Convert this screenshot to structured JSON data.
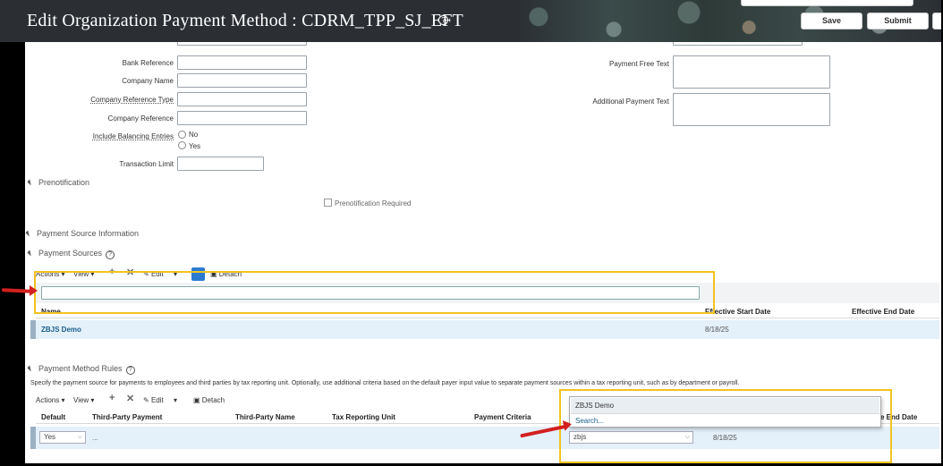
{
  "header": {
    "title": "Edit Organization Payment Method : CDRM_TPP_SJ_EFT",
    "help": "?",
    "save_label": "Save",
    "submit_label": "Submit"
  },
  "form": {
    "bank_reference": "Bank Reference",
    "company_name": "Company Name",
    "company_reference_type": "Company Reference Type",
    "company_reference": "Company Reference",
    "include_balancing_entries": "Include Balancing Entries",
    "no": "No",
    "yes": "Yes",
    "transaction_limit": "Transaction Limit",
    "payment_free_text": "Payment Free Text",
    "additional_payment_text": "Additional Payment Text"
  },
  "prenotification": {
    "section": "Prenotification",
    "required_label": "Prenotification Required"
  },
  "payment_source_information": "Payment Source Information",
  "payment_sources": {
    "section": "Payment Sources",
    "toolbar": {
      "actions": "Actions",
      "view": "View",
      "edit": "Edit",
      "detach": "Detach"
    },
    "columns": {
      "name": "Name",
      "effective_start": "Effective Start Date",
      "effective_end": "Effective End Date"
    },
    "rows": [
      {
        "name": "ZBJS Demo",
        "start": "8/18/25",
        "end": ""
      }
    ]
  },
  "payment_method_rules": {
    "section": "Payment Method Rules",
    "description": "Specify the payment source for payments to employees and third parties by tax reporting unit. Optionally, use additional criteria based on the default payer input value to separate payment sources within a tax reporting unit, such as by department or payroll.",
    "toolbar": {
      "actions": "Actions",
      "view": "View",
      "edit": "Edit",
      "detach": "Detach"
    },
    "columns": {
      "default": "Default",
      "third_party_payment": "Third-Party Payment",
      "third_party_name": "Third-Party Name",
      "tax_reporting_unit": "Tax Reporting Unit",
      "payment_criteria": "Payment Criteria",
      "end_date": "e End Date"
    },
    "row": {
      "default": "Yes",
      "third_party_payment": "...",
      "payment_source_value": "zbjs",
      "start": "8/18/25"
    },
    "dropdown": {
      "option": "ZBJS Demo",
      "search": "Search..."
    }
  },
  "colors": {
    "highlight_box": "#f2c322",
    "annotation_arrow": "#d32020",
    "link": "#1a5f8a",
    "row_highlight": "#e4f0fa"
  }
}
